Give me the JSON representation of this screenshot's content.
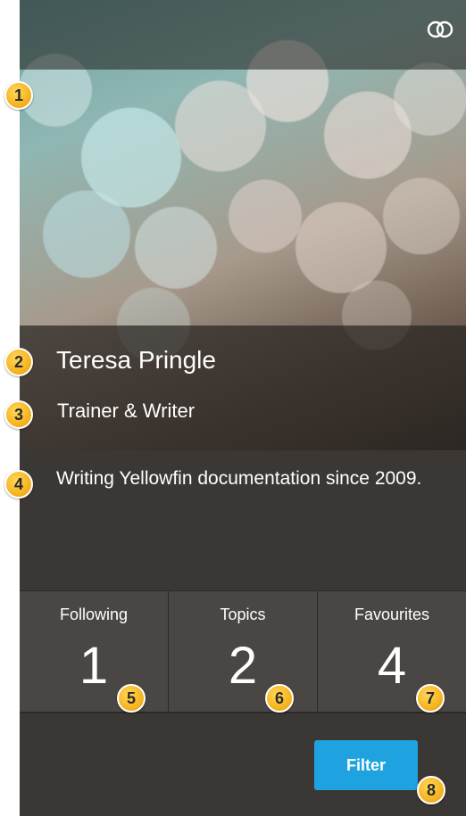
{
  "profile": {
    "name": "Teresa Pringle",
    "role": "Trainer & Writer",
    "bio": "Writing Yellowfin documentation since 2009."
  },
  "header": {
    "icon": "linked-rings-icon"
  },
  "stats": [
    {
      "label": "Following",
      "value": "1"
    },
    {
      "label": "Topics",
      "value": "2"
    },
    {
      "label": "Favourites",
      "value": "4"
    }
  ],
  "actions": {
    "filter_label": "Filter"
  },
  "callouts": [
    "1",
    "2",
    "3",
    "4",
    "5",
    "6",
    "7",
    "8"
  ],
  "colors": {
    "panel_bg": "#3b3734",
    "stat_bg": "#4a4643",
    "filter_button": "#1ea3e0",
    "callout_badge": "#f6b421"
  }
}
